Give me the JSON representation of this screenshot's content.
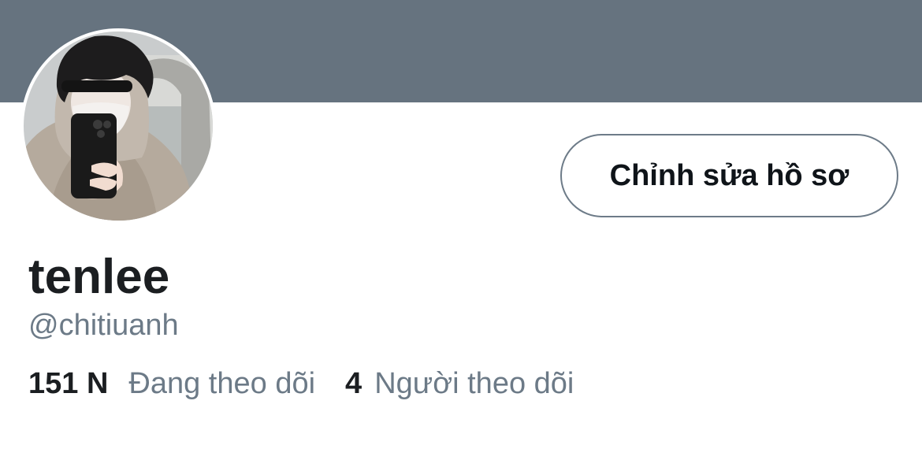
{
  "colors": {
    "banner": "#66737f",
    "text_primary": "#1b1e21",
    "text_secondary": "#6c7a87",
    "button_border": "#6d7b88"
  },
  "profile": {
    "display_name": "tenlee",
    "handle": "@chitiuanh",
    "avatar_icon": "profile-photo"
  },
  "actions": {
    "edit_profile_label": "Chỉnh sửa hồ sơ"
  },
  "stats": {
    "following_count": "151 N",
    "following_label": "Đang theo dõi",
    "followers_count": "4",
    "followers_label": "Người theo dõi"
  }
}
